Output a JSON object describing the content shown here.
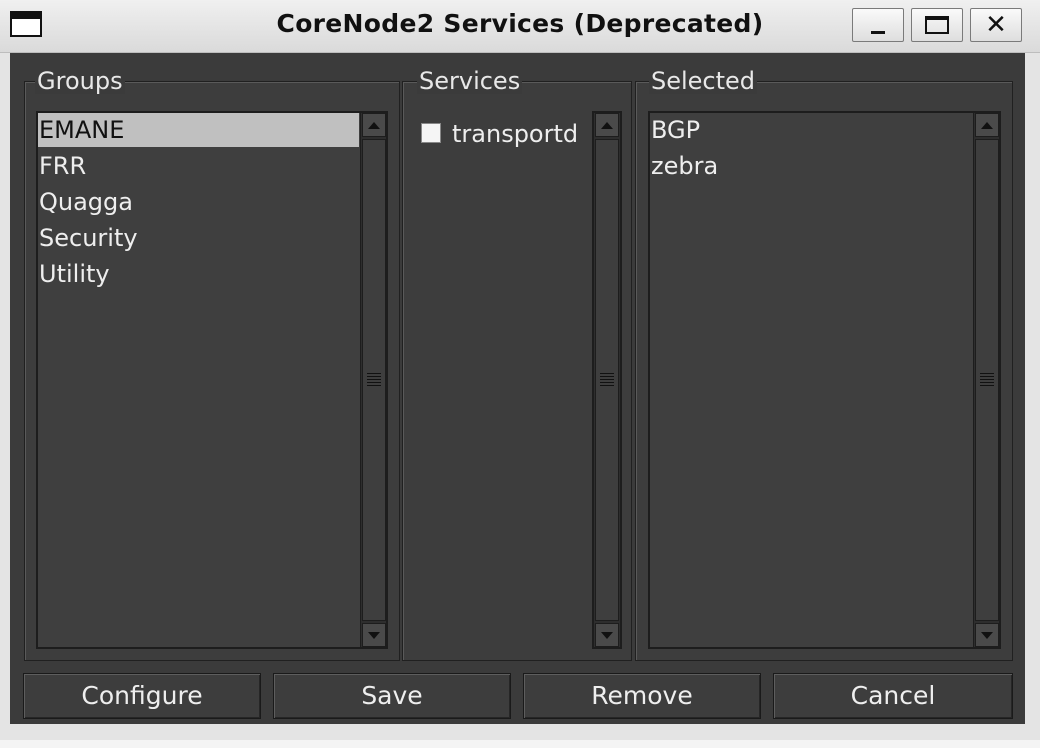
{
  "window": {
    "title": "CoreNode2 Services (Deprecated)",
    "controls": {
      "minimize": "minimize-icon",
      "maximize": "maximize-icon",
      "close": "close-icon"
    }
  },
  "groups": {
    "label": "Groups",
    "items": [
      "EMANE",
      "FRR",
      "Quagga",
      "Security",
      "Utility"
    ],
    "selected": "EMANE"
  },
  "services": {
    "label": "Services",
    "items": [
      {
        "label": "transportd",
        "checked": false
      }
    ]
  },
  "selected": {
    "label": "Selected",
    "items": [
      "BGP",
      "zebra"
    ]
  },
  "buttons": {
    "configure": "Configure",
    "save": "Save",
    "remove": "Remove",
    "cancel": "Cancel"
  },
  "colors": {
    "body_bg": "#3b3b3b",
    "selection_bg": "#c0c0c0",
    "text": "#eeeeee"
  }
}
